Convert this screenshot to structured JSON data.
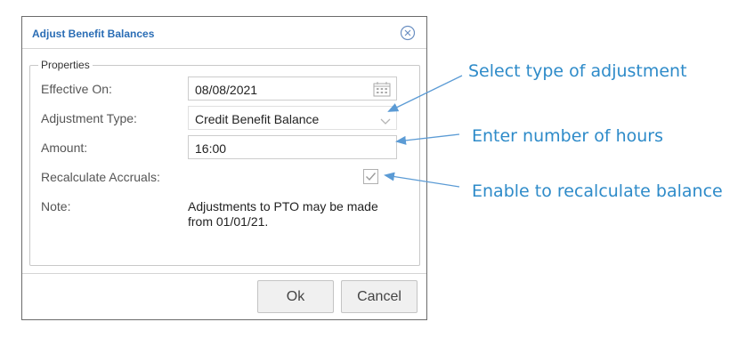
{
  "dialog": {
    "title": "Adjust Benefit Balances",
    "legend": "Properties",
    "fields": {
      "effective_on": {
        "label": "Effective On:",
        "value": "08/08/2021"
      },
      "adjustment_type": {
        "label": "Adjustment Type:",
        "value": "Credit Benefit Balance"
      },
      "amount": {
        "label": "Amount:",
        "value": "16:00"
      },
      "recalculate": {
        "label": "Recalculate Accruals:",
        "checked": true
      },
      "note": {
        "label": "Note:",
        "value": "Adjustments to PTO may be made from 01/01/21."
      }
    },
    "buttons": {
      "ok": "Ok",
      "cancel": "Cancel"
    }
  },
  "callouts": {
    "type": "Select type of adjustment",
    "hours": "Enter number of hours",
    "recalc": "Enable to recalculate balance"
  },
  "colors": {
    "title_blue": "#2a6db5",
    "callout_blue": "#2e8bc9",
    "arrow_blue": "#5b9bd5"
  },
  "icons": [
    "close-circle-icon",
    "calendar-icon",
    "chevron-down-icon",
    "checkbox-checked-icon"
  ]
}
